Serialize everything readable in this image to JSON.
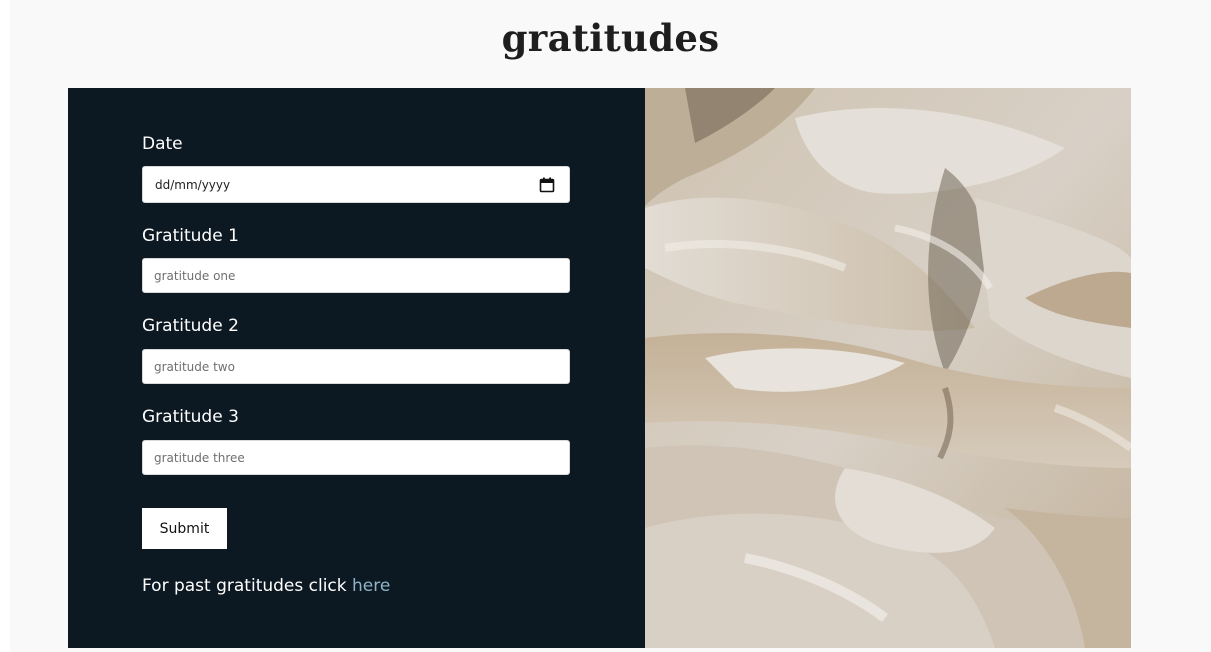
{
  "header": {
    "title": "gratitudes"
  },
  "form": {
    "date": {
      "label": "Date",
      "value": "dd/mm/yyyy",
      "icon": "calendar-icon"
    },
    "gratitude_1": {
      "label": "Gratitude 1",
      "placeholder": "gratitude one"
    },
    "gratitude_2": {
      "label": "Gratitude 2",
      "placeholder": "gratitude two"
    },
    "gratitude_3": {
      "label": "Gratitude 3",
      "placeholder": "gratitude three"
    },
    "submit_label": "Submit"
  },
  "footer": {
    "past_text": "For past gratitudes click ",
    "past_link": "here"
  },
  "colors": {
    "panel_background": "#0d1922",
    "page_background": "#f9f9f9",
    "link": "#8fb3c7"
  }
}
